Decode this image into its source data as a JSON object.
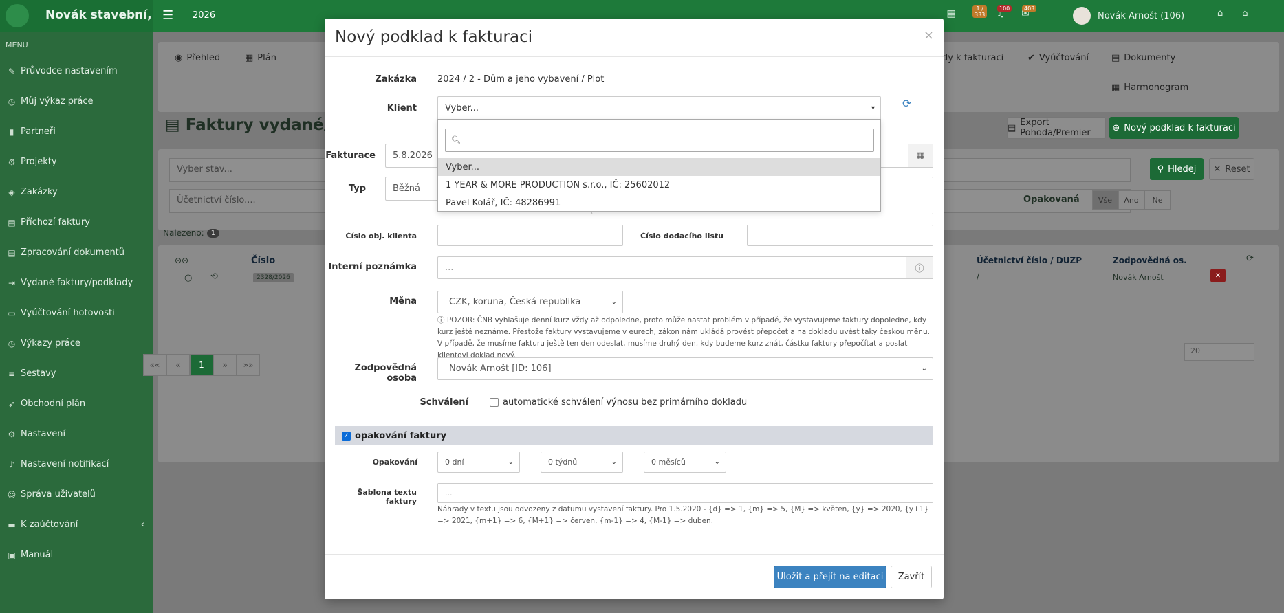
{
  "app": {
    "brand": "Novák stavební,",
    "year": "2026",
    "user_name": "Novák Arnošt (106)",
    "badges": [
      "1 / 333",
      "100",
      "403"
    ]
  },
  "sidebar": {
    "menu_label": "MENU",
    "items": [
      {
        "label": "Průvodce nastavením",
        "icon": "pencil-icon"
      },
      {
        "label": "Můj výkaz práce",
        "icon": "clock-icon"
      },
      {
        "label": "Partneři",
        "icon": "building-icon"
      },
      {
        "label": "Projekty",
        "icon": "cogs-icon"
      },
      {
        "label": "Zakázky",
        "icon": "cube-icon"
      },
      {
        "label": "Příchozí faktury",
        "icon": "file-icon"
      },
      {
        "label": "Zpracování dokumentů",
        "icon": "file-icon"
      },
      {
        "label": "Vydané faktury/podklady",
        "icon": "export-icon"
      },
      {
        "label": "Vyúčtování hotovosti",
        "icon": "card-icon"
      },
      {
        "label": "Výkazy práce",
        "icon": "clock-icon"
      },
      {
        "label": "Sestavy",
        "icon": "list-icon"
      },
      {
        "label": "Obchodní plán",
        "icon": "rocket-icon"
      },
      {
        "label": "Nastavení",
        "icon": "gears-icon"
      },
      {
        "label": "Nastavení notifikací",
        "icon": "bell-icon"
      },
      {
        "label": "Správa uživatelů",
        "icon": "users-icon"
      },
      {
        "label": "K zaúčtování",
        "icon": "folder-icon"
      },
      {
        "label": "Manuál",
        "icon": "book-icon"
      }
    ]
  },
  "background": {
    "tabs": [
      "Přehled",
      "Plán",
      "dy k fakturaci",
      "Vyúčtování",
      "Dokumenty",
      "Harmonogram"
    ],
    "page_title": "Faktury vydané/p",
    "export_btn": "Export Pohoda/Premier",
    "new_btn": "Nový podklad k fakturaci",
    "search_btn": "Hledej",
    "reset_btn": "Reset",
    "filter_state_ph": "Vyber stav...",
    "filter_account_ph": "Účetnictví číslo....",
    "repeat_label": "Opakovaná",
    "repeat_opts": [
      "Vše",
      "Ano",
      "Ne"
    ],
    "found_label": "Nalezeno:",
    "found_count": "1",
    "col_number": "Číslo",
    "col_account": "Účetnictví číslo / DUZP",
    "col_resp": "Zodpovědná os.",
    "row_number": "2328/2026",
    "row_account": "/",
    "row_resp": "Novák Arnošt",
    "pager": [
      "««",
      "«",
      "1",
      "»",
      "»»"
    ],
    "page_size": "20"
  },
  "modal": {
    "title": "Nový podklad k fakturaci",
    "zakazka_label": "Zakázka",
    "zakazka_value": "2024 / 2 - Dům a jeho vybavení / Plot",
    "klient_label": "Klient",
    "klient_value": "Vyber...",
    "klient_dropdown": {
      "options": [
        "Vyber...",
        "1 YEAR & MORE PRODUCTION s.r.o., IČ: 25602012",
        "Pavel Kolář, IČ: 48286991"
      ]
    },
    "fakturace_label": "Fakturace",
    "fakturace_value": "5.8.2026",
    "typ_label": "Typ",
    "typ_value": "Běžná",
    "obj_label": "Číslo obj. klienta",
    "dodaci_label": "Číslo dodacího listu",
    "poznamka_label": "Interní poznámka",
    "poznamka_ph": "...",
    "mena_label": "Měna",
    "mena_value": "CZK, koruna, Česká republika",
    "mena_note": "POZOR: ČNB vyhlašuje denní kurz vždy až odpoledne, proto může nastat problém v případě, že vystavujeme faktury dopoledne, kdy kurz ještě neznáme. Přestože faktury vystavujeme v eurech, zákon nám ukládá provést přepočet a na dokladu uvést taky českou měnu. V případě, že musíme fakturu ještě ten den odeslat, musíme druhý den, kdy budeme kurz znát, částku faktury přepočítat a poslat klientovi doklad nový.",
    "zodp_label": "Zodpovědná osoba",
    "zodp_value": "Novák Arnošt [ID: 106]",
    "schvaleni_label": "Schválení",
    "schvaleni_text": "automatické schválení výnosu bez primárního dokladu",
    "opakovani_section": "opakování faktury",
    "opakovani_label": "Opakování",
    "opak_dni": "0 dní",
    "opak_tydnu": "0 týdnů",
    "opak_mesicu": "0 měsíců",
    "sablona_label": "Šablona textu faktury",
    "sablona_ph": "...",
    "sablona_note": "Náhrady v textu jsou odvozeny z datumu vystavení faktury. Pro 1.5.2020 - {d} => 1, {m} => 5, {M} => květen, {y} => 2020, {y+1} => 2021, {m+1} => 6, {M+1} => červen, {m-1} => 4, {M-1} => duben.",
    "save_btn": "Uložit a přejít na editaci",
    "close_btn": "Zavřít"
  }
}
